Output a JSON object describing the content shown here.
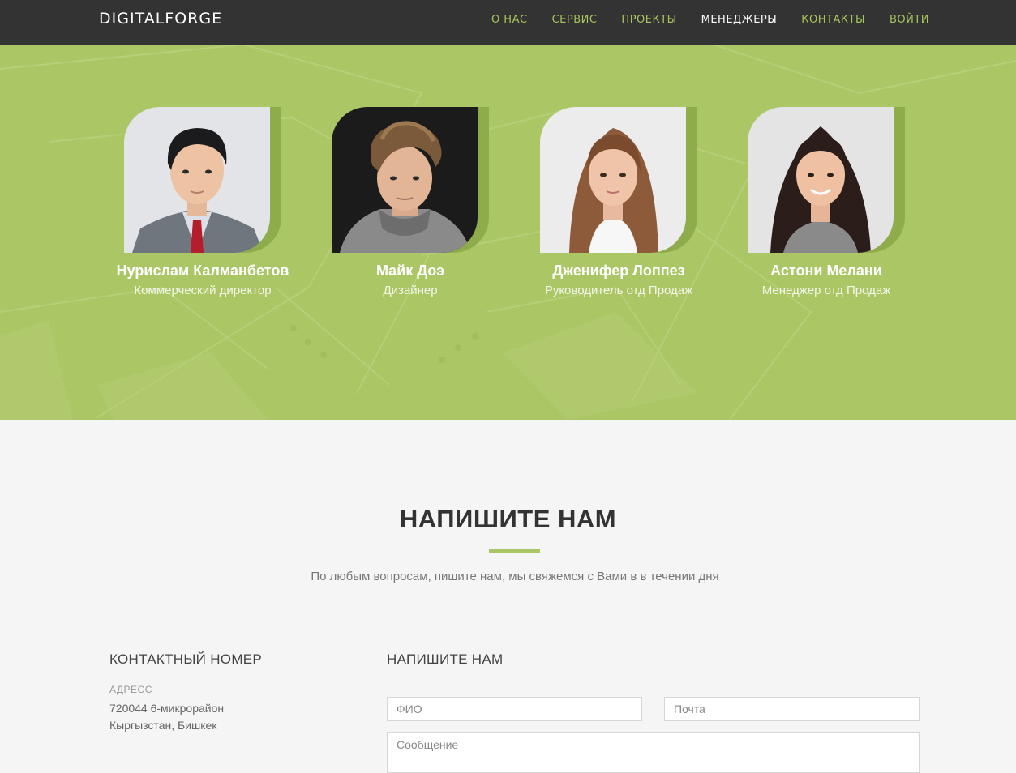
{
  "nav": {
    "brand": "DIGITALFORGE",
    "items": [
      {
        "label": "О НАС",
        "active": false
      },
      {
        "label": "СЕРВИС",
        "active": false
      },
      {
        "label": "ПРОЕКТЫ",
        "active": false
      },
      {
        "label": "МЕНЕДЖЕРЫ",
        "active": true
      },
      {
        "label": "КОНТАКТЫ",
        "active": false
      },
      {
        "label": "ВОЙТИ",
        "active": false
      }
    ]
  },
  "team": {
    "members": [
      {
        "name": "Нурислам Калманбетов",
        "role": "Коммерческий директор"
      },
      {
        "name": "Майк Доэ",
        "role": "Дизайнер"
      },
      {
        "name": "Дженифер Лоппез",
        "role": "Руководитель отд Продаж"
      },
      {
        "name": "Астони Мелани",
        "role": "Менеджер отд Продаж"
      }
    ]
  },
  "contact": {
    "title": "НАПИШИТЕ НАМ",
    "subtitle": "По любым вопросам, пишите нам, мы свяжемся с Вами в в течении дня",
    "phone_heading": "КОНТАКТНЫЙ НОМЕР",
    "address_label": "АДРЕСС",
    "address_line1": "720044 6-микрорайон",
    "address_line2": "Кыргызстан, Бишкек",
    "form_heading": "НАПИШИТЕ НАМ",
    "name_placeholder": "ФИО",
    "email_placeholder": "Почта",
    "message_placeholder": "Сообщение"
  },
  "colors": {
    "accent": "#abc665",
    "nav_bg": "#333333",
    "page_bg": "#f5f5f5"
  }
}
